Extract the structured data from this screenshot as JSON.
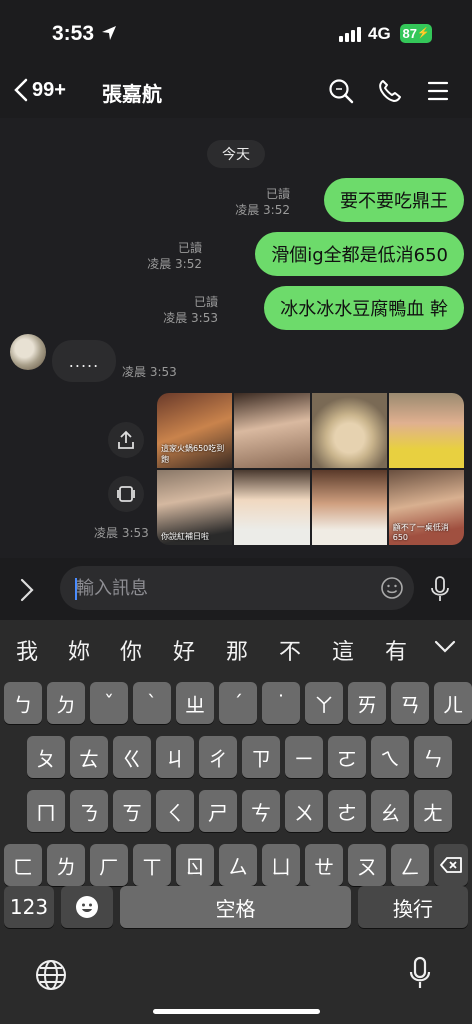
{
  "status": {
    "time": "3:53",
    "network": "4G",
    "battery": "87"
  },
  "header": {
    "back_count": "99+",
    "title": "張嘉航"
  },
  "chat": {
    "date": "今天",
    "outgoing": [
      {
        "text": "要不要吃鼎王",
        "read": "已讀",
        "time": "凌晨 3:52"
      },
      {
        "text": "滑個ig全都是低消650",
        "read": "已讀",
        "time": "凌晨 3:52"
      },
      {
        "text": "冰水冰水豆腐鴨血 幹",
        "read": "已讀",
        "time": "凌晨 3:53"
      }
    ],
    "incoming": {
      "text": ".....",
      "time": "凌晨 3:53"
    },
    "media": {
      "time": "凌晨 3:53",
      "thumbs": [
        "",
        "",
        "",
        "",
        "",
        "",
        "",
        ""
      ],
      "captions": [
        "這家火鍋650吃到飽",
        "",
        "",
        "",
        "你說紅補日啦",
        "",
        "",
        "顧不了一桌低消650"
      ]
    }
  },
  "input": {
    "placeholder": "輸入訊息"
  },
  "keyboard": {
    "candidates": [
      "我",
      "妳",
      "你",
      "好",
      "那",
      "不",
      "這",
      "有"
    ],
    "row1": [
      "ㄅ",
      "ㄉ",
      "ˇ",
      "ˋ",
      "ㄓ",
      "ˊ",
      "˙",
      "ㄚ",
      "ㄞ",
      "ㄢ",
      "ㄦ"
    ],
    "row2": [
      "ㄆ",
      "ㄊ",
      "ㄍ",
      "ㄐ",
      "ㄔ",
      "ㄗ",
      "ㄧ",
      "ㄛ",
      "ㄟ",
      "ㄣ"
    ],
    "row3": [
      "ㄇ",
      "ㄋ",
      "ㄎ",
      "ㄑ",
      "ㄕ",
      "ㄘ",
      "ㄨ",
      "ㄜ",
      "ㄠ",
      "ㄤ"
    ],
    "row4": [
      "ㄈ",
      "ㄌ",
      "ㄏ",
      "ㄒ",
      "ㄖ",
      "ㄙ",
      "ㄩ",
      "ㄝ",
      "ㄡ",
      "ㄥ"
    ],
    "num_label": "123",
    "space_label": "空格",
    "return_label": "換行"
  }
}
